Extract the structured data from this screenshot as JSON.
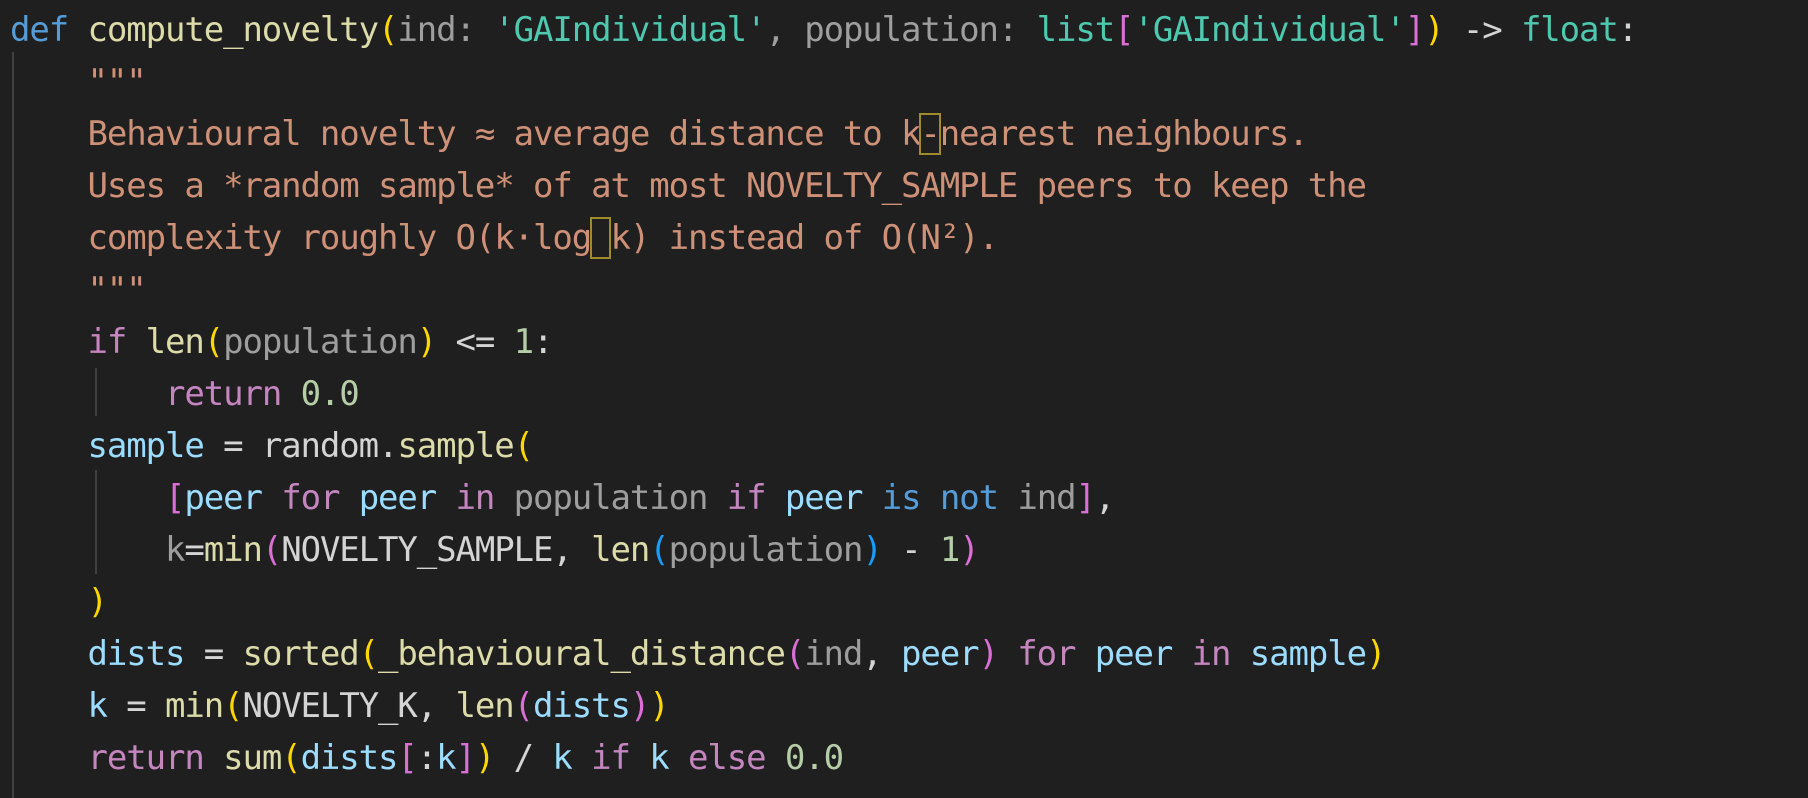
{
  "editor": {
    "language": "python",
    "lines": [
      {
        "indent": "",
        "tokens": [
          {
            "t": "def",
            "c": "kw"
          },
          {
            "t": " ",
            "c": "pl"
          },
          {
            "t": "compute_novelty",
            "c": "fn"
          },
          {
            "t": "(",
            "c": "b1"
          },
          {
            "t": "ind",
            "c": "par"
          },
          {
            "t": ": ",
            "c": "par"
          },
          {
            "t": "'GAIndividual'",
            "c": "str"
          },
          {
            "t": ", ",
            "c": "par"
          },
          {
            "t": "population",
            "c": "par"
          },
          {
            "t": ": ",
            "c": "par"
          },
          {
            "t": "list",
            "c": "str"
          },
          {
            "t": "[",
            "c": "b2"
          },
          {
            "t": "'GAIndividual'",
            "c": "str"
          },
          {
            "t": "]",
            "c": "b2"
          },
          {
            "t": ")",
            "c": "b1"
          },
          {
            "t": " -> ",
            "c": "pl"
          },
          {
            "t": "float",
            "c": "str"
          },
          {
            "t": ":",
            "c": "pl"
          }
        ]
      },
      {
        "indent": "    ",
        "tokens": [
          {
            "t": "\"\"\"",
            "c": "doc"
          }
        ]
      },
      {
        "indent": "    ",
        "tokens": [
          {
            "t": "Behavioural novelty ≈ average distance to k",
            "c": "doc"
          },
          {
            "t": "-",
            "c": "doc",
            "hl": true
          },
          {
            "t": "nearest neighbours.",
            "c": "doc"
          }
        ]
      },
      {
        "indent": "    ",
        "tokens": [
          {
            "t": "Uses a *random sample* of at most NOVELTY_SAMPLE peers to keep the",
            "c": "doc"
          }
        ]
      },
      {
        "indent": "    ",
        "tokens": [
          {
            "t": "complexity roughly O(k·log",
            "c": "doc"
          },
          {
            "t": " ",
            "c": "doc",
            "hl": true
          },
          {
            "t": "k) instead of O(N²).",
            "c": "doc"
          }
        ]
      },
      {
        "indent": "    ",
        "tokens": [
          {
            "t": "\"\"\"",
            "c": "doc"
          }
        ]
      },
      {
        "indent": "    ",
        "tokens": [
          {
            "t": "if",
            "c": "ctl"
          },
          {
            "t": " ",
            "c": "pl"
          },
          {
            "t": "len",
            "c": "fn"
          },
          {
            "t": "(",
            "c": "b1"
          },
          {
            "t": "population",
            "c": "par"
          },
          {
            "t": ")",
            "c": "b1"
          },
          {
            "t": " <= ",
            "c": "pl"
          },
          {
            "t": "1",
            "c": "num"
          },
          {
            "t": ":",
            "c": "pl"
          }
        ]
      },
      {
        "indent": "        ",
        "tokens": [
          {
            "t": "return",
            "c": "ctl"
          },
          {
            "t": " ",
            "c": "pl"
          },
          {
            "t": "0.0",
            "c": "num"
          }
        ]
      },
      {
        "indent": "    ",
        "tokens": [
          {
            "t": "sample",
            "c": "var"
          },
          {
            "t": " = ",
            "c": "pl"
          },
          {
            "t": "random",
            "c": "pl"
          },
          {
            "t": ".",
            "c": "pl"
          },
          {
            "t": "sample",
            "c": "fn"
          },
          {
            "t": "(",
            "c": "b1"
          }
        ]
      },
      {
        "indent": "        ",
        "tokens": [
          {
            "t": "[",
            "c": "b2"
          },
          {
            "t": "peer",
            "c": "var"
          },
          {
            "t": " ",
            "c": "pl"
          },
          {
            "t": "for",
            "c": "ctl"
          },
          {
            "t": " ",
            "c": "pl"
          },
          {
            "t": "peer",
            "c": "var"
          },
          {
            "t": " ",
            "c": "pl"
          },
          {
            "t": "in",
            "c": "ctl"
          },
          {
            "t": " ",
            "c": "pl"
          },
          {
            "t": "population",
            "c": "par"
          },
          {
            "t": " ",
            "c": "pl"
          },
          {
            "t": "if",
            "c": "ctl"
          },
          {
            "t": " ",
            "c": "pl"
          },
          {
            "t": "peer",
            "c": "var"
          },
          {
            "t": " ",
            "c": "pl"
          },
          {
            "t": "is",
            "c": "kw"
          },
          {
            "t": " ",
            "c": "pl"
          },
          {
            "t": "not",
            "c": "kw"
          },
          {
            "t": " ",
            "c": "pl"
          },
          {
            "t": "ind",
            "c": "par"
          },
          {
            "t": "]",
            "c": "b2"
          },
          {
            "t": ",",
            "c": "pl"
          }
        ]
      },
      {
        "indent": "        ",
        "tokens": [
          {
            "t": "k",
            "c": "par"
          },
          {
            "t": "=",
            "c": "pl"
          },
          {
            "t": "min",
            "c": "fn"
          },
          {
            "t": "(",
            "c": "b2"
          },
          {
            "t": "NOVELTY_SAMPLE",
            "c": "pl"
          },
          {
            "t": ", ",
            "c": "pl"
          },
          {
            "t": "len",
            "c": "fn"
          },
          {
            "t": "(",
            "c": "b3"
          },
          {
            "t": "population",
            "c": "par"
          },
          {
            "t": ")",
            "c": "b3"
          },
          {
            "t": " - ",
            "c": "pl"
          },
          {
            "t": "1",
            "c": "num"
          },
          {
            "t": ")",
            "c": "b2"
          }
        ]
      },
      {
        "indent": "    ",
        "tokens": [
          {
            "t": ")",
            "c": "b1"
          }
        ]
      },
      {
        "indent": "    ",
        "tokens": [
          {
            "t": "dists",
            "c": "var"
          },
          {
            "t": " = ",
            "c": "pl"
          },
          {
            "t": "sorted",
            "c": "fn"
          },
          {
            "t": "(",
            "c": "b1"
          },
          {
            "t": "_behavioural_distance",
            "c": "fn"
          },
          {
            "t": "(",
            "c": "b2"
          },
          {
            "t": "ind",
            "c": "par"
          },
          {
            "t": ", ",
            "c": "pl"
          },
          {
            "t": "peer",
            "c": "var"
          },
          {
            "t": ")",
            "c": "b2"
          },
          {
            "t": " ",
            "c": "pl"
          },
          {
            "t": "for",
            "c": "ctl"
          },
          {
            "t": " ",
            "c": "pl"
          },
          {
            "t": "peer",
            "c": "var"
          },
          {
            "t": " ",
            "c": "pl"
          },
          {
            "t": "in",
            "c": "ctl"
          },
          {
            "t": " ",
            "c": "pl"
          },
          {
            "t": "sample",
            "c": "var"
          },
          {
            "t": ")",
            "c": "b1"
          }
        ]
      },
      {
        "indent": "    ",
        "tokens": [
          {
            "t": "k",
            "c": "var"
          },
          {
            "t": " = ",
            "c": "pl"
          },
          {
            "t": "min",
            "c": "fn"
          },
          {
            "t": "(",
            "c": "b1"
          },
          {
            "t": "NOVELTY_K",
            "c": "pl"
          },
          {
            "t": ", ",
            "c": "pl"
          },
          {
            "t": "len",
            "c": "fn"
          },
          {
            "t": "(",
            "c": "b2"
          },
          {
            "t": "dists",
            "c": "var"
          },
          {
            "t": ")",
            "c": "b2"
          },
          {
            "t": ")",
            "c": "b1"
          }
        ]
      },
      {
        "indent": "    ",
        "tokens": [
          {
            "t": "return",
            "c": "ctl"
          },
          {
            "t": " ",
            "c": "pl"
          },
          {
            "t": "sum",
            "c": "fn"
          },
          {
            "t": "(",
            "c": "b1"
          },
          {
            "t": "dists",
            "c": "var"
          },
          {
            "t": "[",
            "c": "b2"
          },
          {
            "t": ":",
            "c": "pl"
          },
          {
            "t": "k",
            "c": "var"
          },
          {
            "t": "]",
            "c": "b2"
          },
          {
            "t": ")",
            "c": "b1"
          },
          {
            "t": " / ",
            "c": "pl"
          },
          {
            "t": "k",
            "c": "var"
          },
          {
            "t": " ",
            "c": "pl"
          },
          {
            "t": "if",
            "c": "ctl"
          },
          {
            "t": " ",
            "c": "pl"
          },
          {
            "t": "k",
            "c": "var"
          },
          {
            "t": " ",
            "c": "pl"
          },
          {
            "t": "else",
            "c": "ctl"
          },
          {
            "t": " ",
            "c": "pl"
          },
          {
            "t": "0.0",
            "c": "num"
          }
        ]
      }
    ]
  }
}
